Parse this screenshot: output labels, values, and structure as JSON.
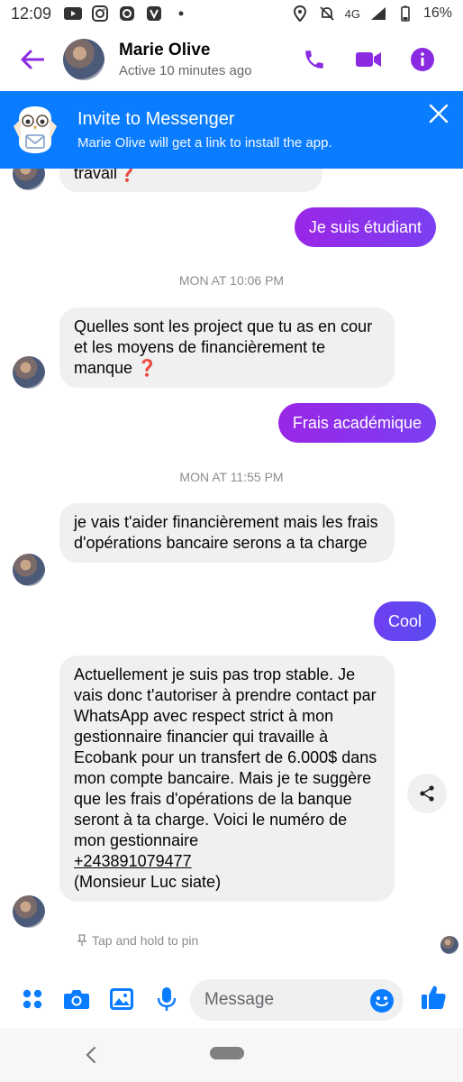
{
  "status_bar": {
    "time": "12:09",
    "network": "4G",
    "battery": "16%"
  },
  "header": {
    "name": "Marie Olive",
    "status": "Active 10 minutes ago"
  },
  "invite": {
    "title": "Invite to Messenger",
    "subtitle": "Marie Olive will get a link to install the app."
  },
  "messages": {
    "partial_in": "travail❓",
    "out1": "Je suis étudiant",
    "ts1": "MON AT 10:06 PM",
    "in1": "Quelles sont les project que tu as en cour et les moyens de financièrement te manque ❓",
    "out2": "Frais académique",
    "ts2": "MON AT 11:55 PM",
    "in2": "je vais t'aider financièrement mais les frais d'opérations bancaire serons a ta charge",
    "out3": "Cool",
    "in3_text": "Actuellement je suis pas trop stable. Je vais donc t'autoriser à prendre contact par WhatsApp avec respect strict à mon gestionnaire financier qui travaille à Ecobank pour un transfert de 6.000$ dans mon compte bancaire. Mais je te suggère que les frais d'opérations de la banque seront à ta charge. Voici le numéro de mon gestionnaire",
    "in3_phone": "+243891079477",
    "in3_tail": " (Monsieur Luc siate)"
  },
  "pin_hint": "Tap and hold to pin",
  "composer": {
    "placeholder": "Message"
  },
  "colors": {
    "accent": "#8a2be2",
    "brand_blue": "#0a7cff",
    "bubble_in": "#f0f0f0"
  }
}
